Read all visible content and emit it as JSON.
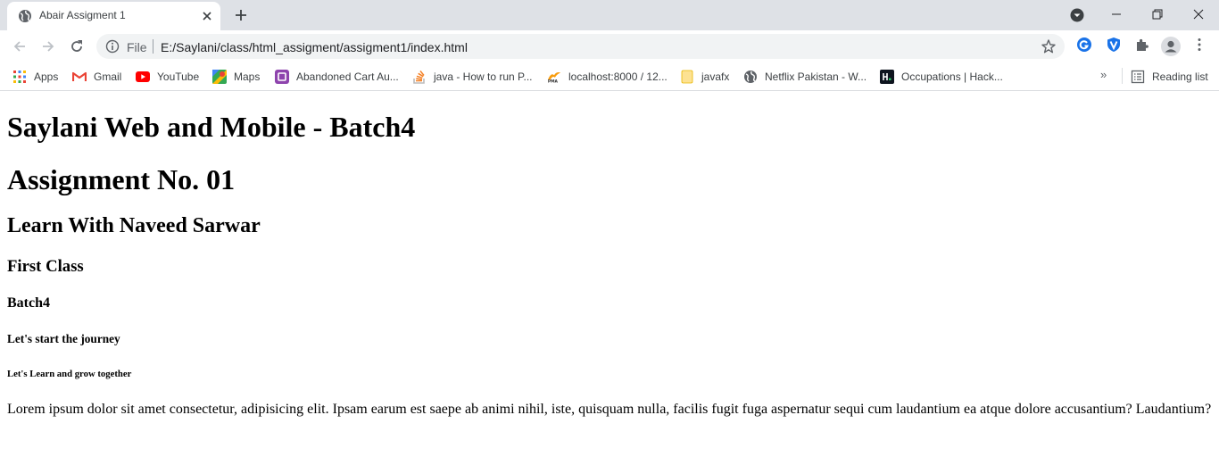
{
  "browser": {
    "tab": {
      "title": "Abair Assigment 1",
      "favicon": "globe-icon"
    },
    "address_bar": {
      "scheme": "File",
      "url": "E:/Saylani/class/html_assigment/assigment1/index.html"
    },
    "bookmarks": [
      {
        "label": "Apps",
        "icon": "apps-grid-icon"
      },
      {
        "label": "Gmail",
        "icon": "gmail-icon"
      },
      {
        "label": "YouTube",
        "icon": "youtube-icon"
      },
      {
        "label": "Maps",
        "icon": "maps-icon"
      },
      {
        "label": "Abandoned Cart Au...",
        "icon": "cart-icon"
      },
      {
        "label": "java - How to run P...",
        "icon": "stackoverflow-icon"
      },
      {
        "label": "localhost:8000 / 12...",
        "icon": "phpmyadmin-icon"
      },
      {
        "label": "javafx",
        "icon": "folder-icon"
      },
      {
        "label": "Netflix Pakistan - W...",
        "icon": "globe-icon"
      },
      {
        "label": "Occupations | Hack...",
        "icon": "hackerrank-icon"
      }
    ],
    "more_bookmarks": "»",
    "reading_list": "Reading list"
  },
  "page": {
    "h1_title": "Saylani Web and Mobile - Batch4",
    "h1_assignment": "Assignment No. 01",
    "h2": "Learn With Naveed Sarwar",
    "h3": "First Class",
    "h4": "Batch4",
    "h5": "Let's start the journey",
    "h6": "Let's Learn and grow together",
    "paragraph": "Lorem ipsum dolor sit amet consectetur, adipisicing elit. Ipsam earum est saepe ab animi nihil, iste, quisquam nulla, facilis fugit fuga aspernatur sequi cum laudantium ea atque dolore accusantium? Laudantium?"
  },
  "colors": {
    "tabstrip_bg": "#dee1e6",
    "omnibox_bg": "#f1f3f4",
    "icon_gray": "#5f6368"
  }
}
